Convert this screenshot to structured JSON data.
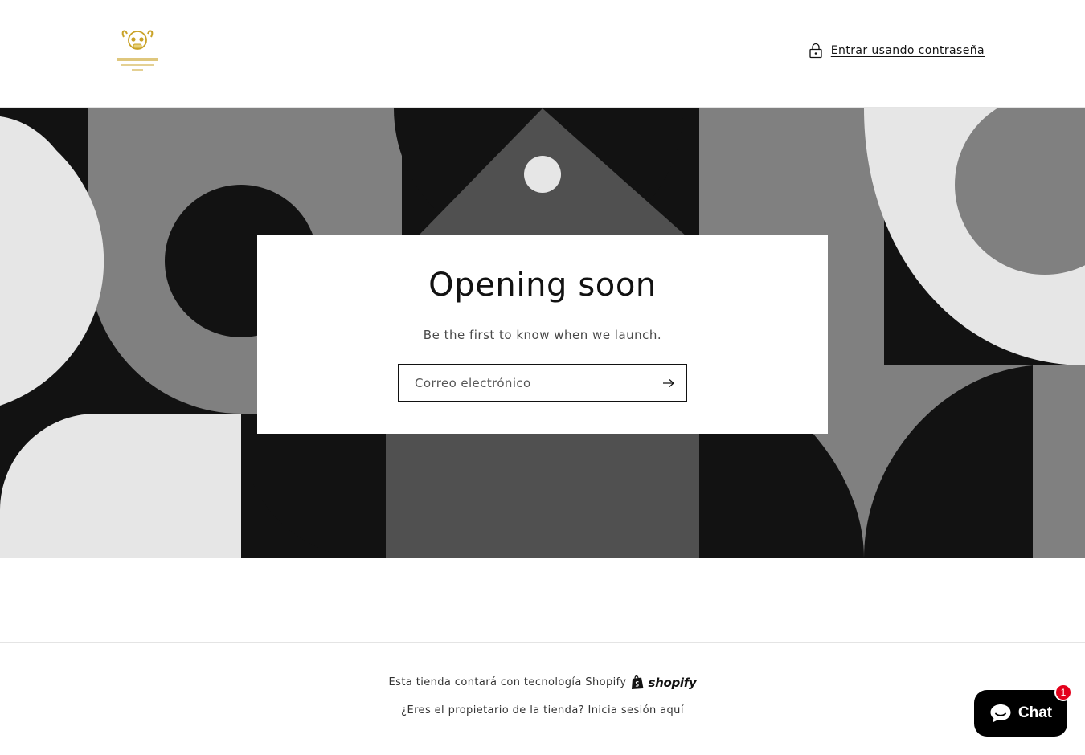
{
  "header": {
    "logo_icon": "brand-logo-icon",
    "login_icon": "lock-icon",
    "login_label": "Entrar usando contraseña"
  },
  "banner": {
    "colors": {
      "dark": "#121212",
      "mid_dark": "#505050",
      "mid": "#808080",
      "light": "#e6e6e6"
    }
  },
  "card": {
    "title": "Opening soon",
    "subtitle": "Be the first to know when we launch.",
    "email_placeholder": "Correo electrónico",
    "submit_icon": "arrow-right-icon"
  },
  "footer": {
    "powered_text": "Esta tienda contará con tecnología Shopify",
    "shopify_word": "shopify",
    "owner_question": "¿Eres el propietario de la tienda?",
    "owner_link": "Inicia sesión aquí"
  },
  "chat": {
    "label": "Chat",
    "badge_count": "1",
    "icon": "chat-bubble-icon"
  }
}
